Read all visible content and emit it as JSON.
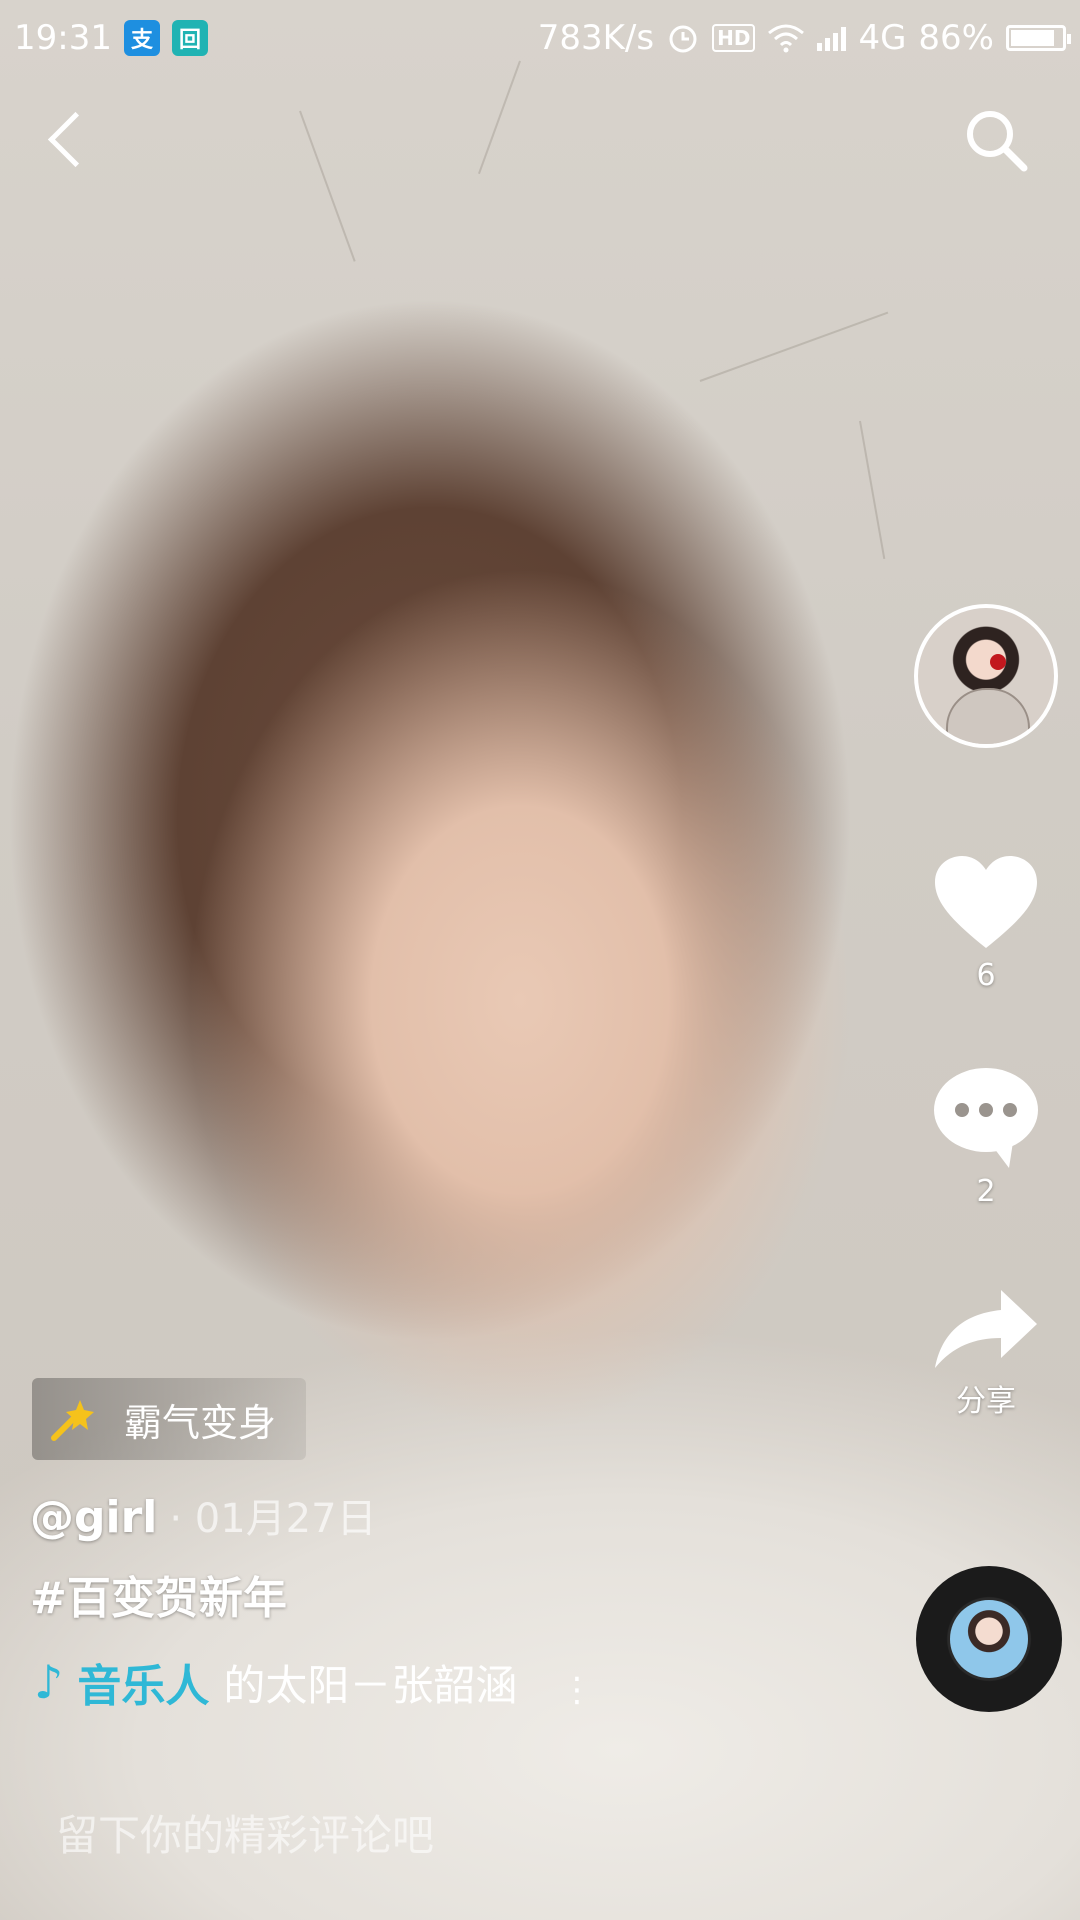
{
  "status_bar": {
    "time": "19:31",
    "app_badge_1": "支",
    "app_badge_2": "回",
    "net_speed": "783K/s",
    "hd_label": "HD",
    "network": "4G",
    "battery": "86%",
    "battery_level": 0.86
  },
  "effect": {
    "label": "霸气变身"
  },
  "post": {
    "author": "@girl",
    "date": "· 01月27日",
    "hashtag": "#百变贺新年"
  },
  "music": {
    "prefix": "音乐人",
    "title": "的太阳－张韶涵",
    "more": "⋮"
  },
  "actions": {
    "like_count": "6",
    "comment_count": "2",
    "share_label": "分享"
  },
  "comment_input": {
    "placeholder": "留下你的精彩评论吧"
  }
}
